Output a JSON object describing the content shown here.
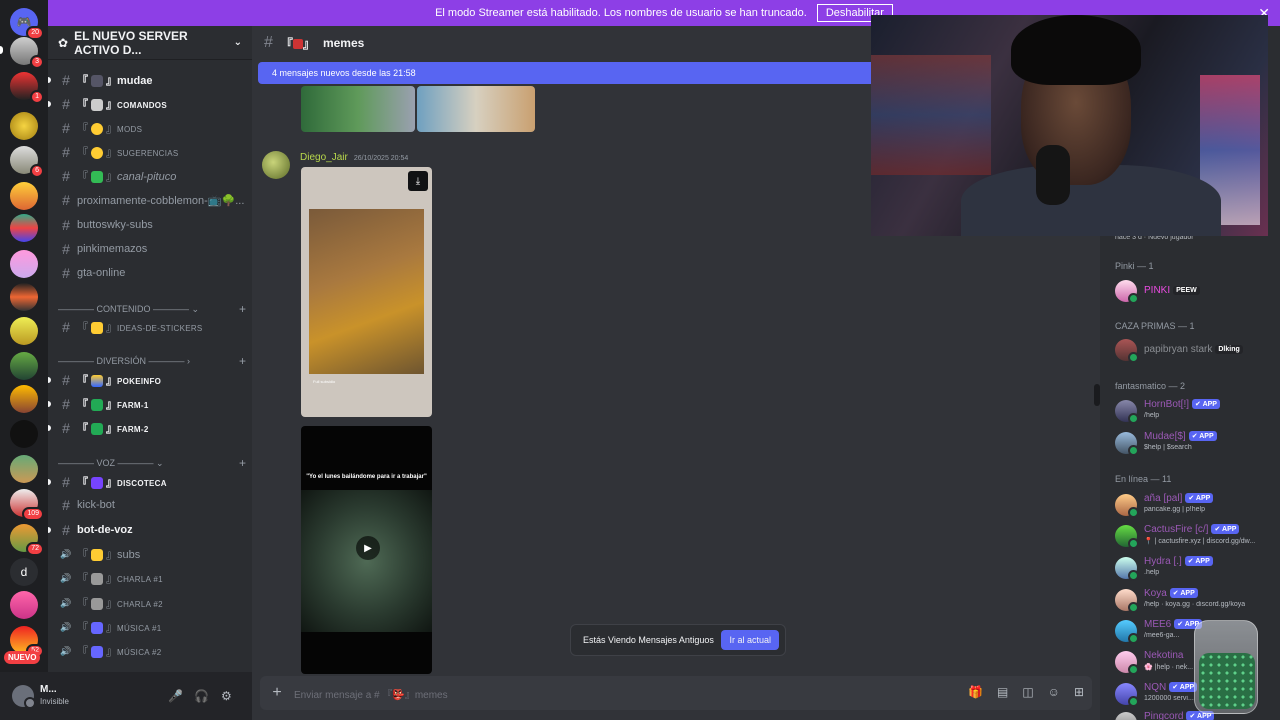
{
  "banner": {
    "text": "El modo Streamer está habilitado. Los nombres de usuario se han truncado.",
    "button": "Deshabilitar",
    "close": "✕"
  },
  "rail": {
    "badges": [
      "20",
      "3",
      "1",
      "6",
      "109",
      "72",
      "52"
    ],
    "d_label": "d",
    "nuevo": "NUEVO"
  },
  "guild": {
    "name": "EL NUEVO SERVER ACTIVO D...",
    "chevron": "⌄"
  },
  "channels": [
    {
      "name": "mudae",
      "bright": true
    },
    {
      "name": "COMANDOS",
      "bright": true
    },
    {
      "name": "MODS"
    },
    {
      "name": "SUGERENCIAS"
    },
    {
      "name": "canal-pituco"
    },
    {
      "name": "proximamente-cobblemon-📺🌳..."
    },
    {
      "name": "buttoswky-subs"
    },
    {
      "name": "pinkimemazos"
    },
    {
      "name": "gta-online"
    },
    {
      "name": "IDEAS-DE-STICKERS"
    },
    {
      "name": "POKEINFO",
      "bright": true
    },
    {
      "name": "FARM-1",
      "bright": true
    },
    {
      "name": "FARM-2",
      "bright": true
    },
    {
      "name": "DISCOTECA",
      "bright": true
    },
    {
      "name": "kick-bot"
    },
    {
      "name": "bot-de-voz",
      "bright": true
    },
    {
      "name": "subs"
    },
    {
      "name": "CHARLA #1"
    },
    {
      "name": "CHARLA #2"
    },
    {
      "name": "MÚSICA #1"
    },
    {
      "name": "MÚSICA #2"
    }
  ],
  "categories": {
    "contenido": "———— CONTENIDO ———— ⌄",
    "diversion": "———— DIVERSIÓN ———— ›",
    "voz": "———— VOZ ———— ⌄",
    "plus": "+"
  },
  "user": {
    "name": "M...",
    "status": "Invisible"
  },
  "chat": {
    "channel": "memes",
    "new_messages": "4 mensajes nuevos desde las 21:58",
    "author": "Diego_Jair",
    "timestamp": "26/10/2025 20:54",
    "caption1": "Full subsidio",
    "video_title": "\"Yo el lunes bailándome para ir a trabajar\"",
    "viewing_text": "Estás Viendo Mensajes Antiguos",
    "jump_button": "Ir al actual",
    "placeholder": "Enviar mensaje a # 『👺』memes"
  },
  "members": {
    "top_status": "hace 3 d  ·  Nuevo jugador",
    "groups": [
      {
        "label": "Pinki — 1",
        "items": [
          {
            "name": "PINKI",
            "tag": "PEEW",
            "color": "#e94be0"
          }
        ]
      },
      {
        "label": "CAZA PRIMAS — 1",
        "items": [
          {
            "name": "papibryan stark",
            "tag": "Dlking",
            "color": "#8a8d92"
          }
        ]
      },
      {
        "label": "fantasmatico — 2",
        "items": [
          {
            "name": "HornBot[!]",
            "tag": "✔ APP",
            "status": "/help",
            "color": "#9b59b6"
          },
          {
            "name": "Mudae[$]",
            "tag": "✔ APP",
            "status": "$help | $search",
            "color": "#9b59b6"
          }
        ]
      },
      {
        "label": "En línea — 11",
        "items": [
          {
            "name": "aña [pal]",
            "tag": "✔ APP",
            "status": "pancake.gg | p!help",
            "color": "#9b59b6"
          },
          {
            "name": "CactusFire [c/]",
            "tag": "✔ APP",
            "status": "📍 | cactusfire.xyz | discord.gg/dw...",
            "color": "#9b59b6"
          },
          {
            "name": "Hydra [.]",
            "tag": "✔ APP",
            "status": ".help",
            "color": "#9b59b6"
          },
          {
            "name": "Koya",
            "tag": "✔ APP",
            "status": "/help · koya.gg · discord.gg/koya",
            "color": "#9b59b6"
          },
          {
            "name": "MEE6",
            "tag": "✔ APP",
            "status": "/mee6-ga...",
            "color": "#9b59b6"
          },
          {
            "name": "Nekotina",
            "tag": "",
            "status": "🌸 |help · nek...",
            "color": "#9b59b6"
          },
          {
            "name": "NQN",
            "tag": "✔ APP",
            "status": "1200000 servi...",
            "color": "#9b59b6"
          },
          {
            "name": "Pingcord",
            "tag": "✔ APP",
            "status": "",
            "color": "#9b59b6"
          }
        ]
      }
    ]
  },
  "icons": {
    "hash": "#",
    "speaker": "🔊",
    "mic": "🎤",
    "headset": "🎧",
    "gear": "⚙",
    "download": "⤓",
    "play": "▶",
    "add": "+"
  }
}
